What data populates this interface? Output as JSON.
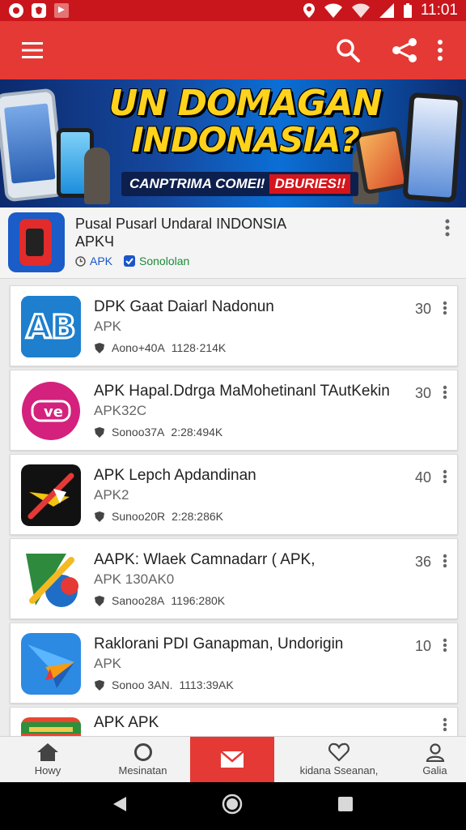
{
  "status_bar": {
    "time": "11:01"
  },
  "app_bar": {
    "menu_icon": "hamburger-icon",
    "search_icon": "search-icon",
    "share_icon": "share-icon",
    "overflow_icon": "kebab-icon",
    "color": "#e53935"
  },
  "banner": {
    "title_line1": "UN DOMAGAN",
    "title_line2": "INDONASIA?",
    "tag1": "CANPTRIMA COMEI!",
    "tag2": "DBURIES!!"
  },
  "featured": {
    "title_line1": "Pusal Pusarl Undaral INDONSIA",
    "title_line2": "APKЧ",
    "meta1": "APK",
    "meta2": "Sonololan"
  },
  "apps": [
    {
      "name": "DPK Gaat Daiarl Nadonun",
      "sub": "APK",
      "meta_a": "Aono+40A",
      "meta_b": "1128·214K",
      "count": "30",
      "icon": "ab-logo-icon"
    },
    {
      "name": "APK Hapal.Ddrga MaMohetinanl TAutKekin",
      "sub": "APK32C",
      "meta_a": "Sonoo37A",
      "meta_b": "2:28:494K",
      "count": "30",
      "icon": "ove-logo-icon"
    },
    {
      "name": "APK Lepch Apdandinan",
      "sub": "APK2",
      "meta_a": "Sunoo20R",
      "meta_b": "2:28:286K",
      "count": "40",
      "icon": "arrow-logo-icon"
    },
    {
      "name": "AAPK: Wlaek Camnadarr ( APK,",
      "sub": "APK   130AK0",
      "meta_a": "Sanoo28A",
      "meta_b": "1196:280K",
      "count": "36",
      "icon": "leaf-logo-icon"
    },
    {
      "name": "Raklorani PDI Ganapman, Undorigin",
      "sub": "APK",
      "meta_a": "Sonoo 3AN.",
      "meta_b": "1113:39AK",
      "count": "10",
      "icon": "plane-logo-icon"
    },
    {
      "name": "APK APK",
      "sub": "",
      "meta_a": "",
      "meta_b": "",
      "count": "",
      "icon": "game-logo-icon"
    }
  ],
  "bottom_nav": [
    {
      "label": "Howy",
      "icon": "home-icon"
    },
    {
      "label": "Mesinatan",
      "icon": "circle-icon"
    },
    {
      "label": "",
      "icon": "mail-icon"
    },
    {
      "label": "kidana Sseanan,",
      "icon": "heart-icon"
    },
    {
      "label": "Galia",
      "icon": "user-icon"
    }
  ]
}
